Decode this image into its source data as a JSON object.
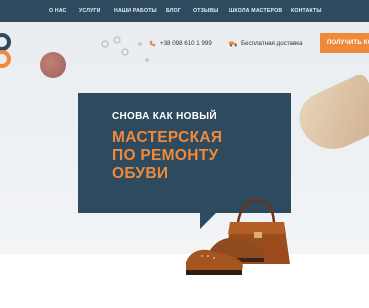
{
  "nav": {
    "items": [
      {
        "label": "О НАС"
      },
      {
        "label": "УСЛУГИ"
      },
      {
        "label": "НАШИ РАБОТЫ"
      },
      {
        "label": "БЛОГ"
      },
      {
        "label": "ОТЗЫВЫ"
      },
      {
        "label": "ШКОЛА МАСТЕРОВ"
      },
      {
        "label": "КОНТАКТЫ"
      }
    ]
  },
  "contact": {
    "phone": "+38 098 610 1 999",
    "phone_icon": "phone-icon",
    "delivery": "Бесплатная доставка",
    "delivery_icon": "truck-icon"
  },
  "cta": {
    "label": "ПОЛУЧИТЬ КО"
  },
  "hero": {
    "subtitle": "СНОВА КАК НОВЫЙ",
    "title_lines": [
      "МАСТЕРСКАЯ",
      "ПО РЕМОНТУ",
      "ОБУВИ"
    ]
  },
  "colors": {
    "nav_bg": "#2e4a5f",
    "accent": "#f08a3a",
    "card_bg": "#2e4a5f"
  }
}
